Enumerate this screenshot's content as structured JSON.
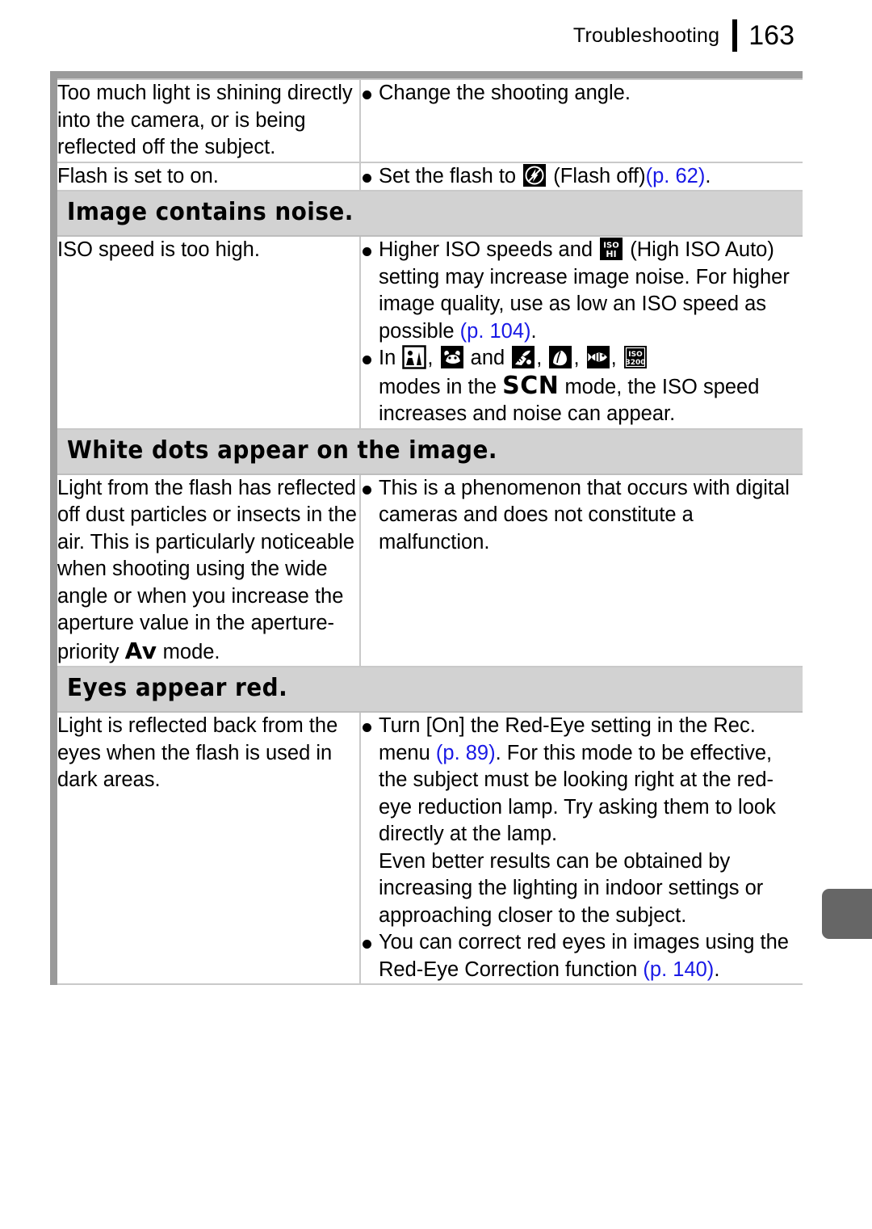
{
  "header": {
    "title": "Troubleshooting",
    "page_number": "163"
  },
  "table": {
    "rows": [
      {
        "type": "data",
        "cause": "Too much light is shining directly into the camera, or is being reflected off the subject.",
        "remedy_lines": [
          "Change the shooting angle."
        ]
      },
      {
        "type": "data",
        "cause": "Flash is set to on.",
        "remedy_parts": {
          "before": "Set the flash to",
          "icon": "flash-off-icon",
          "middle": "(Flash off)",
          "pref": "(p. 62)",
          "after": "."
        }
      },
      {
        "type": "section",
        "title": "Image contains noise."
      },
      {
        "type": "data",
        "cause": "ISO speed is too high.",
        "remedy_bullet1": {
          "t1": "Higher ISO speeds and",
          "icon": "high-iso-auto-icon",
          "t2": "(High ISO Auto) setting may increase image noise. For higher image quality, use as low an ISO speed as possible",
          "pref": "(p. 104)",
          "t3": "."
        },
        "remedy_bullet2": {
          "t1": "In",
          "icons": [
            "night-snapshot-icon",
            "kids-and-pets-icon",
            "indoor-icon",
            "foliage-icon",
            "underwater-icon",
            "iso-3200-icon"
          ],
          "and": "and",
          "t2": "modes in the",
          "mode": "SCN",
          "t3": "mode, the ISO speed increases and noise can appear."
        }
      },
      {
        "type": "section",
        "title": "White dots appear on the image."
      },
      {
        "type": "data",
        "cause_parts": {
          "text": "Light from the flash has reflected off dust particles or insects in the air. This is particularly noticeable when shooting using the wide angle or when you increase the aperture value in the aperture-priority",
          "mode": "Av",
          "tail": "mode."
        },
        "remedy_lines": [
          "This is a phenomenon that occurs with digital cameras and does not constitute a malfunction."
        ]
      },
      {
        "type": "section",
        "title": "Eyes appear red."
      },
      {
        "type": "data",
        "cause": "Light is reflected back from the eyes when the flash is used in dark areas.",
        "remedy_bullet1": {
          "t1": "Turn [On] the Red-Eye setting in the Rec. menu",
          "pref": "(p. 89)",
          "t2": ". For this mode to be effective, the subject must be looking right at the red-eye reduction lamp. Try asking them to look directly at the lamp."
        },
        "remedy_cont": "Even better results can be obtained by increasing the lighting in indoor settings or approaching closer to the subject.",
        "remedy_bullet2": {
          "t1": "You can correct red eyes in images using the Red-Eye Correction function",
          "pref": "(p. 140)",
          "t2": "."
        }
      }
    ]
  },
  "colors": {
    "page_reference": "#1919e6",
    "section_band": "#d2d2d2",
    "frame": "#9a9a9a",
    "edge_tab": "#666666"
  }
}
